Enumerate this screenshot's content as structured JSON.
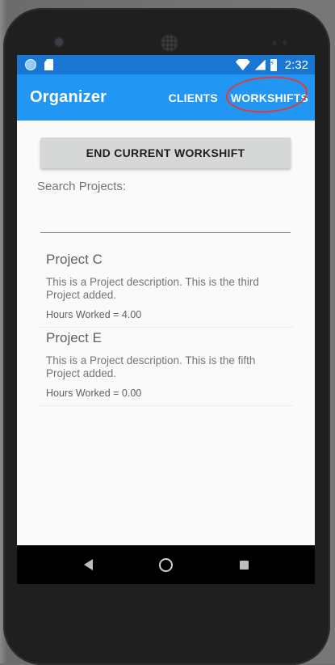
{
  "status_bar": {
    "time": "2:32",
    "icons": [
      "notification-dot-icon",
      "sd-card-icon",
      "wifi-icon",
      "signal-icon",
      "battery-charging-icon"
    ]
  },
  "app_bar": {
    "title": "Organizer",
    "actions": [
      {
        "label": "CLIENTS"
      },
      {
        "label": "WORKSHIFTS"
      }
    ],
    "colors": {
      "toolbar": "#2196f3",
      "status": "#1976d2",
      "annotation": "#e53935"
    }
  },
  "main": {
    "end_button_label": "END CURRENT WORKSHIFT",
    "search_label": "Search Projects:",
    "search_value": "",
    "projects": [
      {
        "title": "Project C",
        "description": "This is a Project description. This is the third Project added.",
        "hours": "Hours Worked = 4.00"
      },
      {
        "title": "Project E",
        "description": "This is a Project description. This is the fifth Project added.",
        "hours": "Hours Worked = 0.00"
      }
    ]
  },
  "nav_bar": {
    "icons": [
      "back-icon",
      "home-icon",
      "recents-icon"
    ]
  }
}
